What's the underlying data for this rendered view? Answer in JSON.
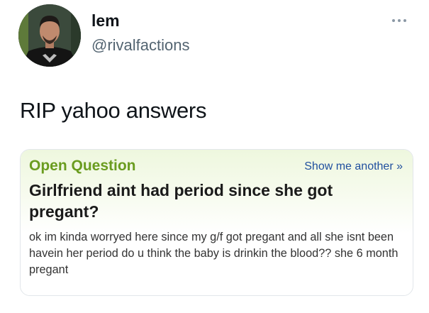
{
  "user": {
    "display_name": "lem",
    "handle": "@rivalfactions",
    "avatar_icon": "user-avatar"
  },
  "tweet": {
    "text": "RIP yahoo answers",
    "more_icon": "ellipsis-icon"
  },
  "question_card": {
    "label": "Open Question",
    "show_another": "Show me another »",
    "title": "Girlfriend aint had period since she got pregant?",
    "body": "ok im kinda worryed here since my g/f got pregant and all she isnt been havein her period do u think the baby is drinkin the blood?? she 6 month pregant"
  },
  "colors": {
    "question_label": "#6a9c1f",
    "show_another_link": "#1f4f9e",
    "card_header_bg": "#eef7de"
  }
}
